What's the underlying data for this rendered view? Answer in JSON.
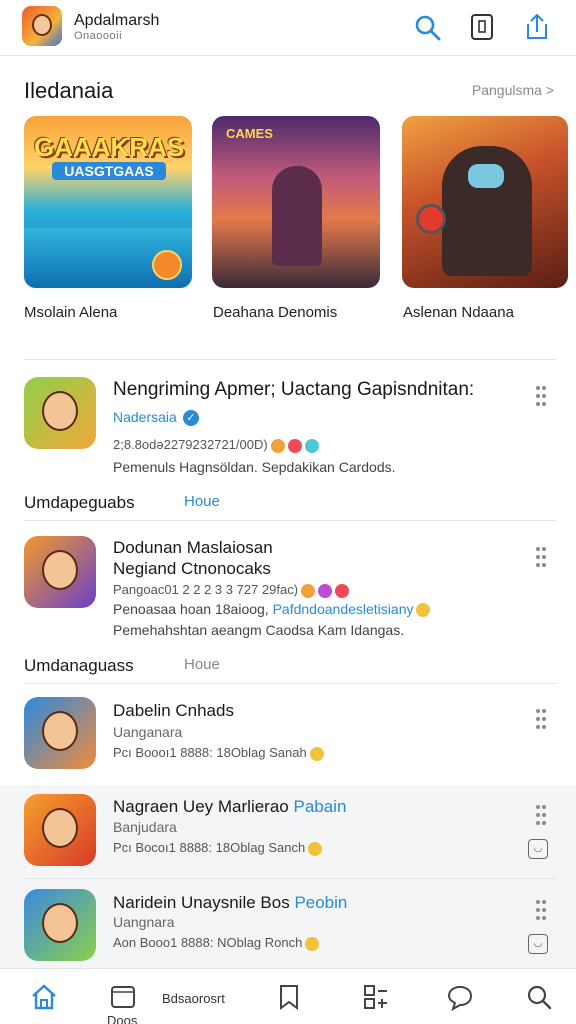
{
  "header": {
    "app_title": "Apdalmarsh",
    "app_subtitle": "Onaoooii"
  },
  "section": {
    "title": "Iledanaia",
    "link": "Pangulsma >"
  },
  "featured": [
    {
      "caption": "Msolain Alena",
      "art_text": "GAAAKRAS",
      "art_sub": "UASGTGAAS"
    },
    {
      "caption": "Deahana Denomis",
      "art_text": "CAMES"
    },
    {
      "caption": "Aslenan Ndaana"
    }
  ],
  "items": [
    {
      "title": "Nengriming Apmer; Uactang Gapisndnitan:",
      "subtitle": "Nadersaia",
      "meta": "2;8.8odə2279232721/00D)",
      "desc": "Pemenuls Hagnsöldan. Sepdakikan Cardods."
    },
    {
      "title": "Dodunan Maslaiosan",
      "title2": "Negiand Ctnonocaks",
      "meta": "Pangoac01 2 2 2 3 3 727 29fac)",
      "desc_plain": "Penoasaa hoan 18aioog,",
      "desc_blue": "Pafdndoandesletisiany",
      "desc2": "Pemehahshtan aeangm Caodsa Kam Idangas."
    },
    {
      "title": "Dabelin Cnhads",
      "subtitle": "Uanganara",
      "meta": "Pcı Boooı1 8888: 18Oblag Sanah"
    },
    {
      "title_plain": "Nagraen Uey Marlierao",
      "title_blue": "Pabain",
      "subtitle": "Banjudara",
      "meta": "Pcı Bocoı1 8888: 18Oblag Sanch"
    },
    {
      "title_plain": "Naridein Unaysnile Bos",
      "title_blue": "Peobin",
      "subtitle": "Uangnara",
      "meta": "Aon Booo1 8888: NOblag Ronch"
    }
  ],
  "subheads": [
    {
      "label": "Umdapeguabs",
      "link": "Houe"
    },
    {
      "label": "Umdanaguass",
      "link": "Houe"
    }
  ],
  "bottom_nav": {
    "tab2_label": "Doos",
    "tab3_label": "Bdsaorosrt"
  },
  "colors": {
    "accent": "#2a8ad9",
    "divider": "#e4e4e4",
    "band": "#f4f5f7"
  }
}
